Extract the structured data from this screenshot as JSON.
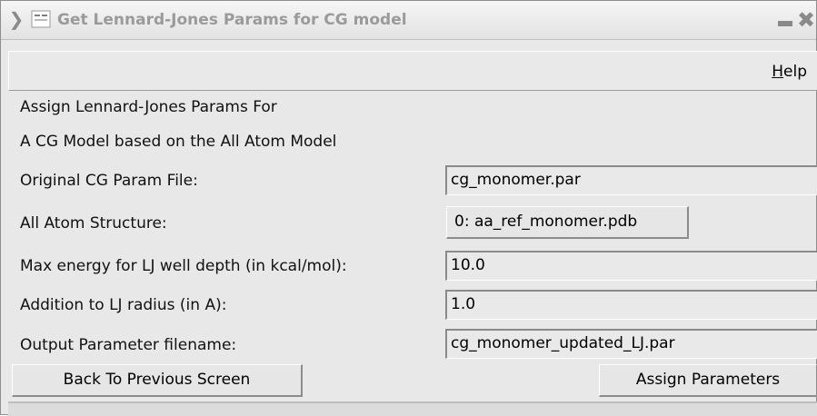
{
  "window": {
    "title": "Get Lennard-Jones Params for CG model"
  },
  "menu": {
    "help_mnemonic": "H",
    "help_rest": "elp"
  },
  "intro": {
    "line1": "Assign Lennard-Jones Params For",
    "line2": "A CG Model based on the All Atom Model"
  },
  "form": {
    "cg_param_file": {
      "label": "Original CG Param File:",
      "value": "cg_monomer.par"
    },
    "aa_structure": {
      "label": "All Atom Structure:",
      "value": "0: aa_ref_monomer.pdb"
    },
    "max_energy": {
      "label": "Max energy for LJ well depth (in kcal/mol):",
      "value": "10.0"
    },
    "lj_radius": {
      "label": "Addition to LJ radius (in A):",
      "value": "1.0"
    },
    "output_file": {
      "label": "Output Parameter filename:",
      "value": "cg_monomer_updated_LJ.par"
    }
  },
  "buttons": {
    "back": "Back To Previous Screen",
    "assign": "Assign Parameters"
  },
  "icons": {
    "window_menu": "chevron-down-icon",
    "app": "app-icon",
    "minimize": "minimize-icon",
    "close": "close-icon"
  },
  "colors": {
    "background": "#e8e8e8",
    "title_text": "#9a9a9a"
  }
}
